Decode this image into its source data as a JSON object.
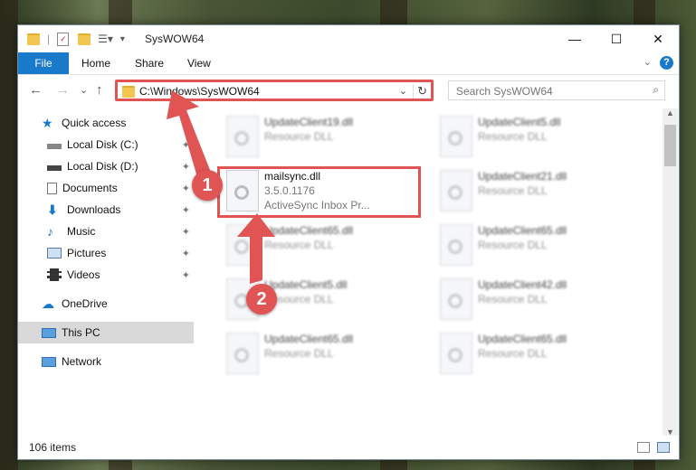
{
  "window": {
    "title": "SysWOW64",
    "controls": {
      "minimize": "—",
      "maximize": "☐",
      "close": "✕"
    }
  },
  "ribbon": {
    "file": "File",
    "tabs": [
      "Home",
      "Share",
      "View"
    ],
    "help": "?",
    "expand": "⌄"
  },
  "nav": {
    "back": "←",
    "forward": "→",
    "recent": "⌄",
    "up": "↑",
    "address": "C:\\Windows\\SysWOW64",
    "address_dropdown": "⌄",
    "refresh": "↻",
    "search_placeholder": "Search SysWOW64",
    "search_icon": "⌕"
  },
  "sidebar": {
    "items": [
      {
        "label": "Quick access",
        "icon": "star-icon",
        "pinned": false
      },
      {
        "label": "Local Disk (C:)",
        "icon": "drive-icon",
        "pinned": true
      },
      {
        "label": "Local Disk (D:)",
        "icon": "drive-icon",
        "pinned": true
      },
      {
        "label": "Documents",
        "icon": "documents-icon",
        "pinned": true
      },
      {
        "label": "Downloads",
        "icon": "download-icon",
        "pinned": true
      },
      {
        "label": "Music",
        "icon": "music-icon",
        "pinned": true
      },
      {
        "label": "Pictures",
        "icon": "pictures-icon",
        "pinned": true
      },
      {
        "label": "Videos",
        "icon": "videos-icon",
        "pinned": true
      },
      {
        "label": "OneDrive",
        "icon": "cloud-icon",
        "pinned": false
      },
      {
        "label": "This PC",
        "icon": "pc-icon",
        "pinned": false
      },
      {
        "label": "Network",
        "icon": "network-icon",
        "pinned": false
      }
    ],
    "pin_glyph": "📌"
  },
  "files": [
    {
      "name": "UpdateClient19.dll",
      "line2": "Resource DLL",
      "line3": ""
    },
    {
      "name": "UpdateClient5.dll",
      "line2": "Resource DLL",
      "line3": ""
    },
    {
      "name": "mailsync.dll",
      "line2": "3.5.0.1176",
      "line3": "ActiveSync Inbox Pr..."
    },
    {
      "name": "UpdateClient21.dll",
      "line2": "Resource DLL",
      "line3": ""
    },
    {
      "name": "UpdateClient65.dll",
      "line2": "Resource DLL",
      "line3": ""
    },
    {
      "name": "UpdateClient65.dll",
      "line2": "Resource DLL",
      "line3": ""
    },
    {
      "name": "UpdateClient5.dll",
      "line2": "Resource DLL",
      "line3": ""
    },
    {
      "name": "UpdateClient42.dll",
      "line2": "Resource DLL",
      "line3": ""
    },
    {
      "name": "UpdateClient65.dll",
      "line2": "Resource DLL",
      "line3": ""
    },
    {
      "name": "UpdateClient65.dll",
      "line2": "Resource DLL",
      "line3": ""
    }
  ],
  "status": {
    "count": "106 items"
  },
  "markers": {
    "one": "1",
    "two": "2"
  },
  "colors": {
    "accent": "#1979ca",
    "annotation": "#e05454"
  }
}
